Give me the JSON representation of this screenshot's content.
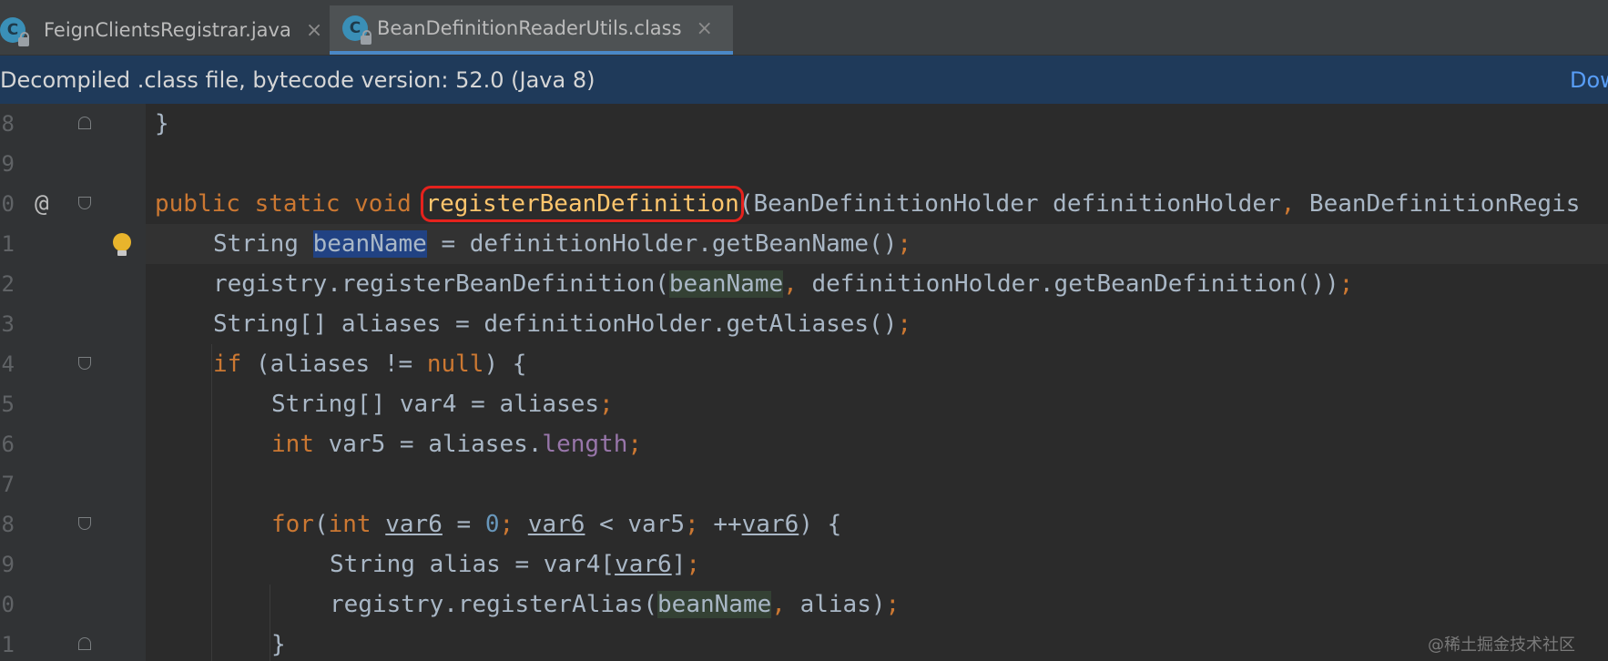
{
  "tabs": [
    {
      "label": "FeignClientsRegistrar.java",
      "icon": "C",
      "active": false
    },
    {
      "label": "BeanDefinitionReaderUtils.class",
      "icon": "C",
      "active": true
    }
  ],
  "tab_close_glyph": "×",
  "banner": {
    "text": "Decompiled .class file, bytecode version: 52.0 (Java 8)",
    "link": "Dow"
  },
  "gutter": {
    "line_numbers": [
      "8",
      "9",
      "0",
      "1",
      "2",
      "3",
      "4",
      "5",
      "6",
      "7",
      "8",
      "9",
      "0",
      "1"
    ],
    "override_marker": "@"
  },
  "code": {
    "l1": {
      "t1": "}"
    },
    "l3": {
      "kw1": "public static void ",
      "name": "registerBeanDefinition",
      "rest1": "(BeanDefinitionHolder definitionHolder",
      "comma": ",",
      "rest2": " BeanDefinitionRegis"
    },
    "l4": {
      "t1": "String ",
      "var": "beanName",
      "t2": " = definitionHolder.getBeanName()",
      "semi": ";"
    },
    "l5": {
      "t1": "registry.registerBeanDefinition(",
      "var": "beanName",
      "comma": ",",
      "t2": " definitionHolder.getBeanDefinition())",
      "semi": ";"
    },
    "l6": {
      "t1": "String[] aliases = definitionHolder.getAliases()",
      "semi": ";"
    },
    "l7": {
      "kw": "if",
      "t1": " (aliases != ",
      "kw2": "null",
      "t2": ") {"
    },
    "l8": {
      "t1": "String[] var4 = aliases",
      "semi": ";"
    },
    "l9": {
      "kw": "int",
      "t1": " var5 = aliases.",
      "field": "length",
      "semi": ";"
    },
    "l11": {
      "kw": "for",
      "t1": "(",
      "kw2": "int",
      "sp": " ",
      "v1": "var6",
      "t2": " = ",
      "num": "0",
      "semi1": ";",
      "sp2": " ",
      "v2": "var6",
      "t3": " < var5",
      "semi2": ";",
      "t4": " ++",
      "v3": "var6",
      "t5": ") {"
    },
    "l12": {
      "t1": "String alias = var4[",
      "v": "var6",
      "t2": "]",
      "semi": ";"
    },
    "l13": {
      "t1": "registry.registerAlias(",
      "var": "beanName",
      "comma": ",",
      "t2": " alias)",
      "semi": ";"
    },
    "l14": {
      "t1": "}"
    }
  },
  "watermark": "@稀土掘金技术社区"
}
